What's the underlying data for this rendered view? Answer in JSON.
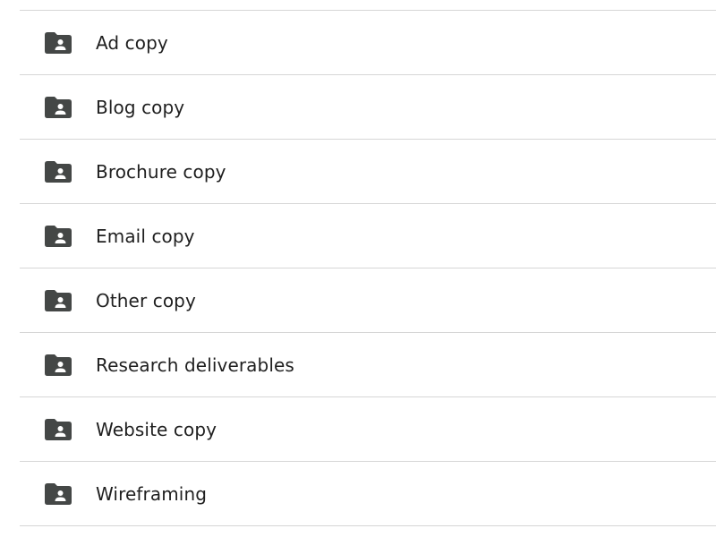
{
  "folders": [
    {
      "name": "Ad copy",
      "icon": "shared-folder-icon"
    },
    {
      "name": "Blog copy",
      "icon": "shared-folder-icon"
    },
    {
      "name": "Brochure copy",
      "icon": "shared-folder-icon"
    },
    {
      "name": "Email copy",
      "icon": "shared-folder-icon"
    },
    {
      "name": "Other copy",
      "icon": "shared-folder-icon"
    },
    {
      "name": "Research deliverables",
      "icon": "shared-folder-icon"
    },
    {
      "name": "Website copy",
      "icon": "shared-folder-icon"
    },
    {
      "name": "Wireframing",
      "icon": "shared-folder-icon"
    }
  ],
  "colors": {
    "icon": "#444746",
    "text": "#1f1f1f",
    "divider": "#d6d6d6"
  }
}
